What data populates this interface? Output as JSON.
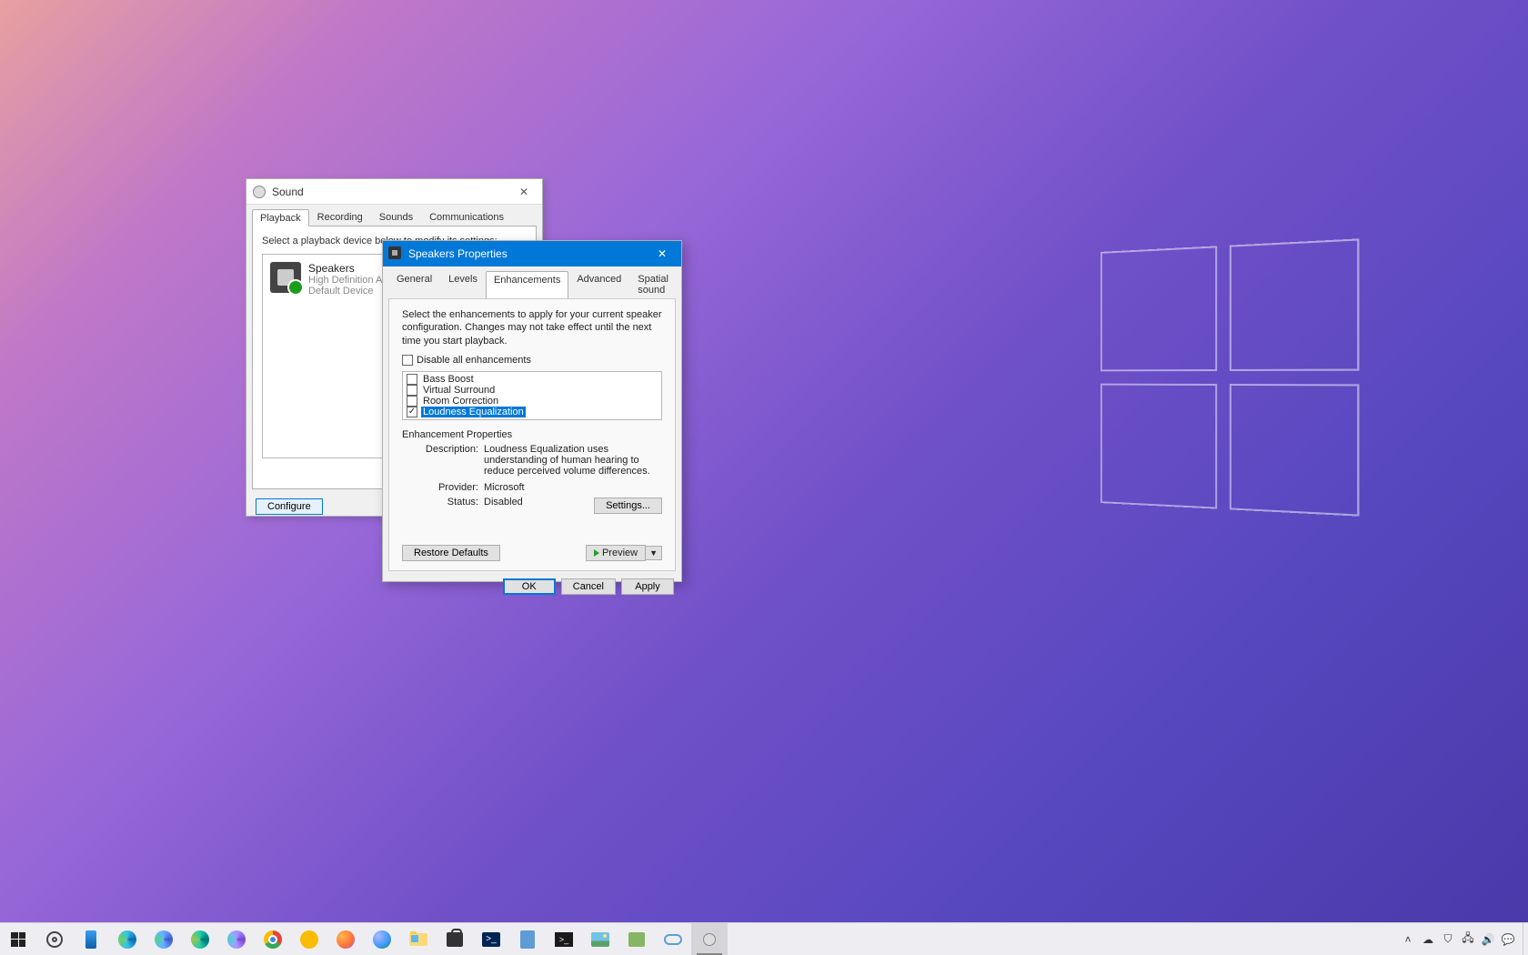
{
  "sound_dialog": {
    "title": "Sound",
    "tabs": [
      "Playback",
      "Recording",
      "Sounds",
      "Communications"
    ],
    "active_tab": 0,
    "instruction": "Select a playback device below to modify its settings:",
    "device": {
      "name": "Speakers",
      "line2": "High Definition Au",
      "line3": "Default Device"
    },
    "configure_btn": "Configure"
  },
  "props_dialog": {
    "title": "Speakers Properties",
    "tabs": [
      "General",
      "Levels",
      "Enhancements",
      "Advanced",
      "Spatial sound"
    ],
    "active_tab": 2,
    "description": "Select the enhancements to apply for your current speaker configuration. Changes may not take effect until the next time you start playback.",
    "disable_all": {
      "label": "Disable all enhancements",
      "checked": false
    },
    "enhancements": [
      {
        "label": "Bass Boost",
        "checked": false,
        "selected": false
      },
      {
        "label": "Virtual Surround",
        "checked": false,
        "selected": false
      },
      {
        "label": "Room Correction",
        "checked": false,
        "selected": false
      },
      {
        "label": "Loudness Equalization",
        "checked": true,
        "selected": true
      }
    ],
    "section_title": "Enhancement Properties",
    "prop_desc_label": "Description:",
    "prop_desc_value": "Loudness Equalization uses understanding of human hearing to reduce perceived volume differences.",
    "prop_provider_label": "Provider:",
    "prop_provider_value": "Microsoft",
    "prop_status_label": "Status:",
    "prop_status_value": "Disabled",
    "settings_btn": "Settings...",
    "restore_btn": "Restore Defaults",
    "preview_btn": "Preview",
    "ok_btn": "OK",
    "cancel_btn": "Cancel",
    "apply_btn": "Apply"
  },
  "taskbar": {
    "items": [
      {
        "name": "start",
        "label": "Start"
      },
      {
        "name": "settings",
        "label": "Settings"
      },
      {
        "name": "phone",
        "label": "Your Phone"
      },
      {
        "name": "edge",
        "label": "Edge"
      },
      {
        "name": "edge-beta",
        "label": "Edge Beta"
      },
      {
        "name": "edge-dev",
        "label": "Edge Dev"
      },
      {
        "name": "edge-canary",
        "label": "Edge Canary"
      },
      {
        "name": "chrome",
        "label": "Chrome"
      },
      {
        "name": "chrome-canary",
        "label": "Chrome Canary"
      },
      {
        "name": "firefox",
        "label": "Firefox"
      },
      {
        "name": "firefox-nightly",
        "label": "Firefox Nightly"
      },
      {
        "name": "explorer",
        "label": "File Explorer"
      },
      {
        "name": "store",
        "label": "Microsoft Store"
      },
      {
        "name": "powershell",
        "label": "PowerShell"
      },
      {
        "name": "notes",
        "label": "Notepad"
      },
      {
        "name": "terminal",
        "label": "Terminal"
      },
      {
        "name": "photos",
        "label": "Photos"
      },
      {
        "name": "task",
        "label": "Task"
      },
      {
        "name": "onedrive",
        "label": "OneDrive"
      },
      {
        "name": "sound-cpl",
        "label": "Sound"
      }
    ],
    "tray": {
      "chevron": "˄",
      "icons": [
        "cloud",
        "security",
        "network",
        "volume",
        "action-center"
      ]
    }
  }
}
